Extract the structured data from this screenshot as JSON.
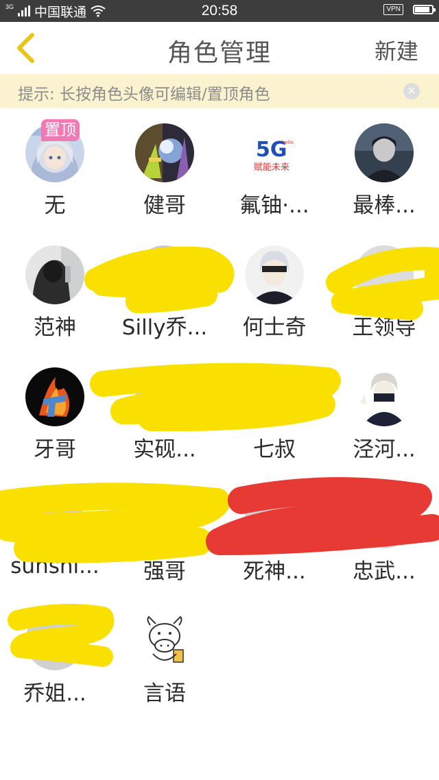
{
  "status_bar": {
    "network_type": "3G",
    "carrier": "中国联通",
    "time": "20:58",
    "vpn_label": "VPN",
    "battery_level": 0.8
  },
  "nav": {
    "back_icon": "chevron-left-icon",
    "title": "角色管理",
    "action_label": "新建",
    "back_color": "#e9c41b"
  },
  "tip": {
    "text": "提示: 长按角色头像可编辑/置顶角色",
    "close_icon": "close-icon",
    "background": "#fbf3cf"
  },
  "pin_badge_label": "置顶",
  "roles": [
    {
      "name": "无",
      "pinned": true
    },
    {
      "name": "健哥"
    },
    {
      "name": "氟铀·..."
    },
    {
      "name": "最棒..."
    },
    {
      "name": "范神"
    },
    {
      "name": "Silly乔..."
    },
    {
      "name": "何士奇"
    },
    {
      "name": "王领导"
    },
    {
      "name": "牙哥"
    },
    {
      "name": "实砚..."
    },
    {
      "name": "七叔"
    },
    {
      "name": "泾河..."
    },
    {
      "name": "sunshi..."
    },
    {
      "name": "强哥"
    },
    {
      "name": "死神..."
    },
    {
      "name": "忠武..."
    },
    {
      "name": "乔姐..."
    },
    {
      "name": "言语"
    }
  ],
  "fiveg_logo": {
    "mark": "5G",
    "small": "hello",
    "slogan": "赋能未来"
  },
  "colors": {
    "redaction_yellow": "#f9e000",
    "redaction_red": "#e83a35",
    "pin_badge": "#f07ab4"
  }
}
